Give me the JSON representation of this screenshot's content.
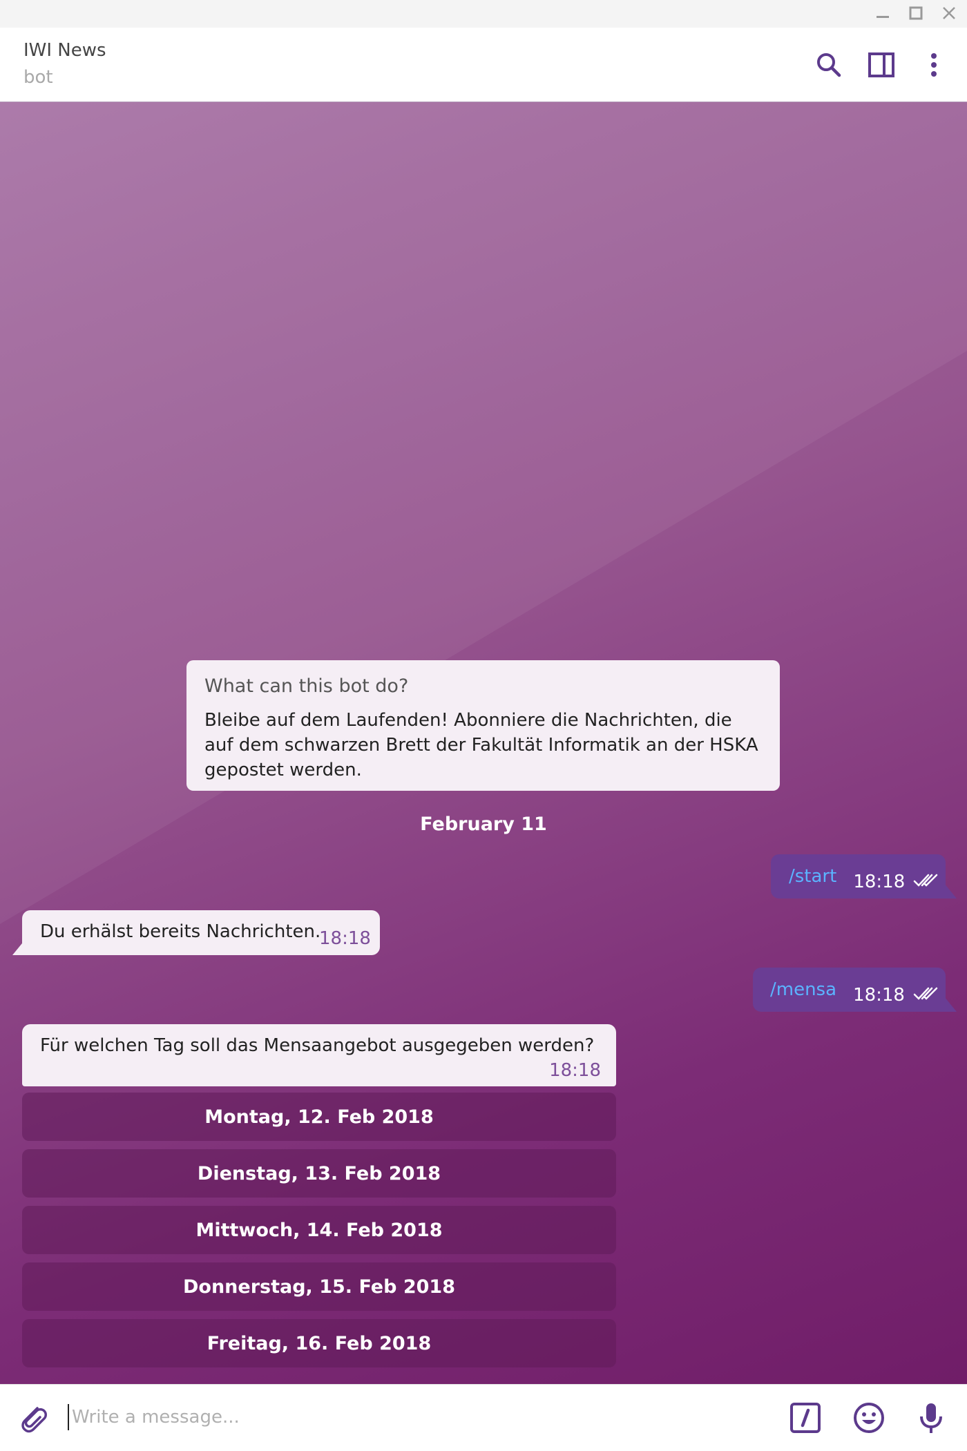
{
  "header": {
    "title": "IWI News",
    "subtitle": "bot"
  },
  "icons": {
    "window": [
      "minimize-icon",
      "maximize-icon",
      "close-icon"
    ],
    "header": [
      "search-icon",
      "sidebar-panel-icon",
      "more-vertical-icon"
    ],
    "composer": [
      "paperclip-icon",
      "bot-command-icon",
      "emoji-icon",
      "microphone-icon"
    ]
  },
  "info_card": {
    "question": "What can this bot do?",
    "answer": "Bleibe auf dem Laufenden! Abonniere die Nachrichten, die auf dem schwarzen Brett der Fakultät Informatik an der HSKA gepostet werden."
  },
  "date_separator": "February 11",
  "messages": [
    {
      "direction": "out",
      "text": "/start",
      "time": "18:18"
    },
    {
      "direction": "in",
      "text": "Du erhälst bereits Nachrichten.",
      "time": "18:18"
    },
    {
      "direction": "out",
      "text": "/mensa",
      "time": "18:18"
    },
    {
      "direction": "in",
      "text": "Für welchen Tag soll das Mensaangebot ausgegeben werden?",
      "time": "18:18"
    }
  ],
  "keyboard": [
    "Montag, 12. Feb 2018",
    "Dienstag, 13. Feb 2018",
    "Mittwoch, 14. Feb 2018",
    "Donnerstag, 15. Feb 2018",
    "Freitag, 16. Feb 2018"
  ],
  "composer": {
    "placeholder": "Write a message...",
    "value": ""
  },
  "colors": {
    "accent": "#6a3d94",
    "command_link": "#5bb3ff",
    "incoming_bubble": "#f5eef5",
    "time_incoming": "#7d4f9a"
  }
}
